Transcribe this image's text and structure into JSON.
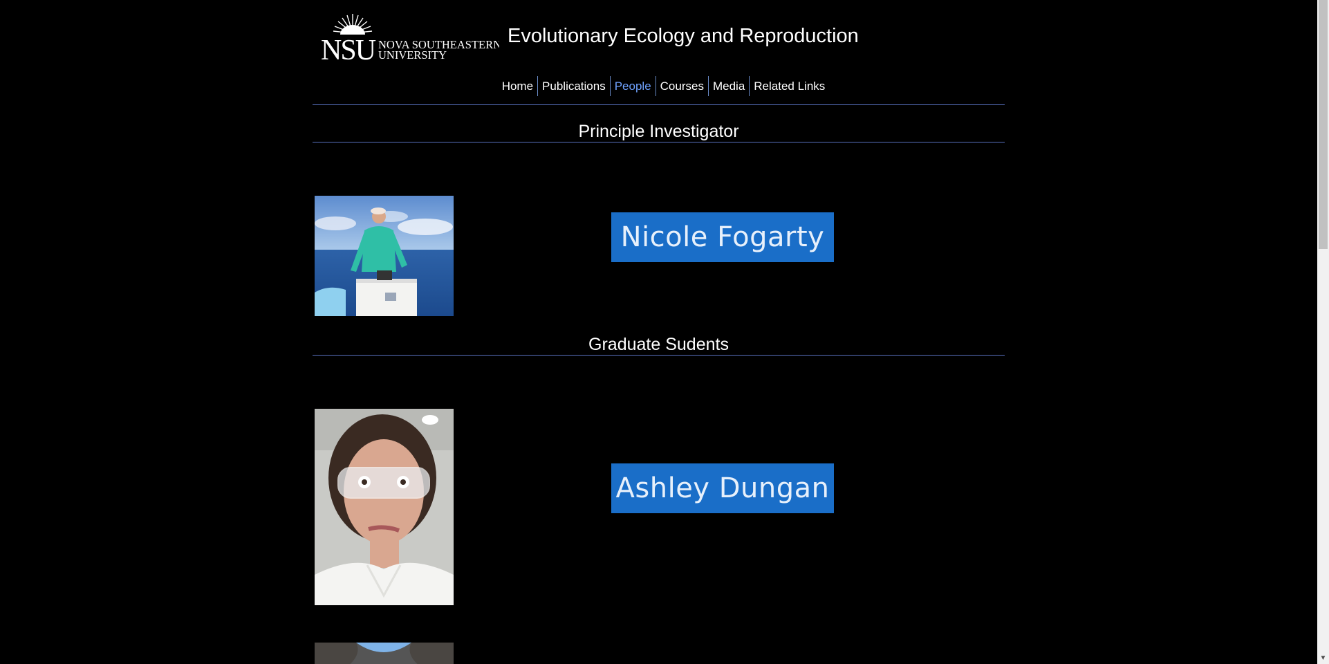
{
  "header": {
    "logo_text": "NSU NOVA SOUTHEASTERN UNIVERSITY",
    "site_title": "Evolutionary Ecology and Reproduction"
  },
  "nav": {
    "items": [
      {
        "label": "Home",
        "active": false
      },
      {
        "label": "Publications",
        "active": false
      },
      {
        "label": "People",
        "active": true
      },
      {
        "label": "Courses",
        "active": false
      },
      {
        "label": "Media",
        "active": false
      },
      {
        "label": "Related Links",
        "active": false
      }
    ]
  },
  "sections": {
    "pi_heading": "Principle Investigator",
    "grad_heading": "Graduate Sudents"
  },
  "people": {
    "pi_name": "Nicole Fogarty",
    "grad1_name": "Ashley Dungan"
  },
  "colors": {
    "background": "#000000",
    "name_box": "#1a6ec8",
    "rule": "#5b74c4",
    "nav_active": "#6fa2ff"
  }
}
